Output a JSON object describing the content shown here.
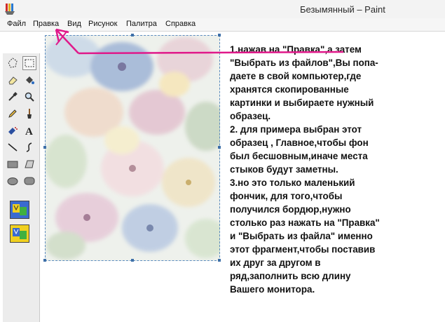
{
  "window": {
    "title": "Безымянный – Paint"
  },
  "menu": {
    "items": [
      "Файл",
      "Правка",
      "Вид",
      "Рисунок",
      "Палитра",
      "Справка"
    ]
  },
  "toolbox": {
    "tools": [
      "free-select-icon",
      "rect-select-icon",
      "eraser-icon",
      "fill-bucket-icon",
      "color-picker-icon",
      "magnifier-icon",
      "pencil-icon",
      "brush-icon",
      "airbrush-icon",
      "text-icon",
      "line-icon",
      "curve-icon",
      "rectangle-icon",
      "polygon-icon",
      "ellipse-icon",
      "rounded-rect-icon"
    ],
    "selected_tool": "rect-select-icon"
  },
  "instructions": {
    "lines": [
      "1.нажав на \"Правка\",а затем",
      "\"Выбрать  из файлов\",Вы попа-",
      "даете в свой компьютер,где",
      "хранятся скопированные",
      "картинки и выбираете нужный",
      "образец.",
      "2. для примера выбран этот",
      "образец , Главное,чтобы фон",
      "был бесшовным,иначе места",
      "стыков будут заметны.",
      "3.но это только маленький",
      "фончик, для того,чтобы",
      "получился бордюр,нужно",
      "столько раз нажать на \"Правка\"",
      "и \"Выбрать из файла\" именно",
      "этот фрагмент,чтобы поставив",
      "их друг за другом в",
      "ряд,заполнить всю длину",
      "Вашего монитора."
    ]
  },
  "colors": {
    "arrow": "#e0198a",
    "selection_border": "#5b8bbf"
  }
}
